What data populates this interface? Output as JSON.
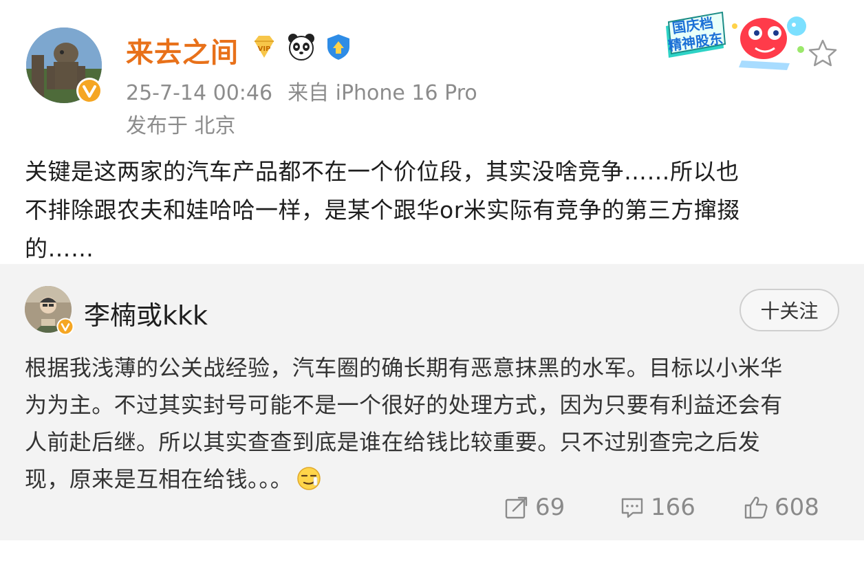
{
  "post": {
    "author": {
      "name": "来去之间",
      "verified": true
    },
    "timestamp": "25-7-14 00:46",
    "source": "来自 iPhone 16 Pro",
    "location": "发布于 北京",
    "promo_badge_text": "国庆档 精神股东",
    "text_lines": [
      "关键是这两家的汽车产品都不在一个价位段，其实没啥竞争……所以也",
      "不排除跟农夫和娃哈哈一样，是某个跟华or米实际有竞争的第三方撺掇",
      "的……"
    ]
  },
  "repost": {
    "author": {
      "name": "李楠或kkk",
      "verified": true
    },
    "follow_label": "十关注",
    "text_lines": [
      "根据我浅薄的公关战经验，汽车圈的确长期有恶意抹黑的水军。目标以小米华",
      "为为主。不过其实封号可能不是一个很好的处理方式，因为只要有利益还会有",
      "人前赴后继。所以其实查查到底是谁在给钱比较重要。只不过别查完之后发",
      "现，原来是互相在给钱。。。"
    ],
    "actions": {
      "repost_count": "69",
      "comment_count": "166",
      "like_count": "608"
    }
  },
  "icons": {
    "vip": "vip-diamond-icon",
    "panda": "panda-icon",
    "shield": "blue-shield-icon",
    "star": "star-outline-icon",
    "repost": "share-icon",
    "comment": "comment-icon",
    "like": "thumbs-up-icon",
    "emoji": "smirk-emoji-icon"
  },
  "colors": {
    "username_orange": "#e8711a",
    "meta_gray": "#8c8c8c",
    "card_background": "#f3f3f3",
    "verified_orange": "#f5a623"
  }
}
